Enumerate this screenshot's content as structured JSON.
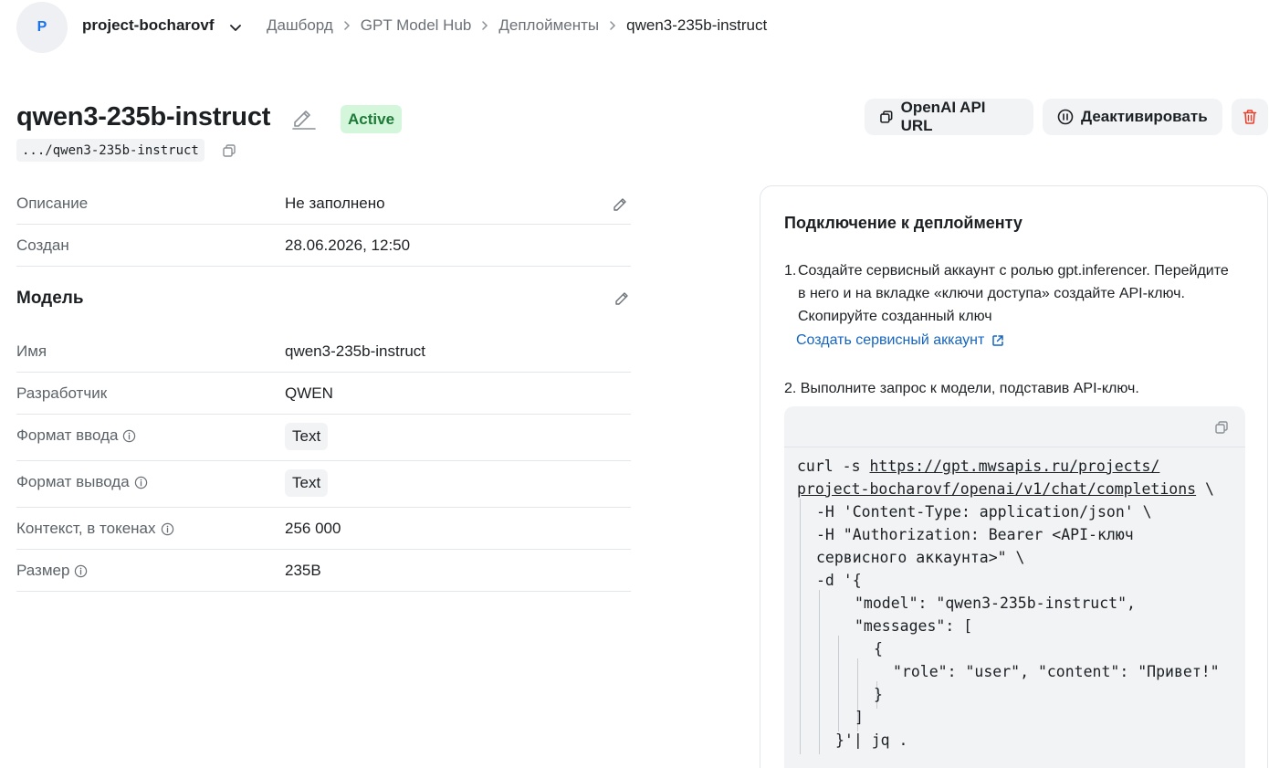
{
  "topbar": {
    "avatar_letter": "P",
    "project_name": "project-bocharovf",
    "breadcrumbs": [
      "Дашборд",
      "GPT Model Hub",
      "Деплойменты",
      "qwen3-235b-instruct"
    ]
  },
  "header": {
    "title": "qwen3-235b-instruct",
    "status": "Active",
    "path": ".../qwen3-235b-instruct",
    "buttons": {
      "api_url": "OpenAI API URL",
      "deactivate": "Деактивировать"
    }
  },
  "details": {
    "description_label": "Описание",
    "description_value": "Не заполнено",
    "created_label": "Создан",
    "created_value": "28.06.2026, 12:50",
    "model_heading": "Модель",
    "name_label": "Имя",
    "name_value": "qwen3-235b-instruct",
    "developer_label": "Разработчик",
    "developer_value": "QWEN",
    "input_format_label": "Формат ввода",
    "input_format_value": "Text",
    "output_format_label": "Формат вывода",
    "output_format_value": "Text",
    "context_label": "Контекст, в токенах",
    "context_value": "256 000",
    "size_label": "Размер",
    "size_value": "235B"
  },
  "connection": {
    "title": "Подключение к деплойменту",
    "step1_num": "1.",
    "step1_text": "Создайте сервисный аккаунт с ролью gpt.inferencer. Перейдите в него и на вкладке «ключи доступа» создайте API-ключ. Скопируйте созданный ключ",
    "create_link": "Создать сервисный аккаунт",
    "step2_text": "2. Выполните запрос к модели, подставив API-ключ.",
    "code": {
      "l1_cmd": "curl -s ",
      "l1_url": "https://gpt.mwsapis.ru/projects/",
      "l2_url": "project-bocharovf/openai/v1/chat/completions",
      "l2_tail": " \\",
      "l3": "-H 'Content-Type: application/json' \\",
      "l4": "-H \"Authorization: Bearer <API-ключ",
      "l5": "сервисного аккаунта>\" \\",
      "l6": "-d '{",
      "l7": "\"model\": \"qwen3-235b-instruct\",",
      "l8": "\"messages\": [",
      "l9": "{",
      "l10": "\"role\": \"user\", \"content\": \"Привет!\"",
      "l11": "}",
      "l12": "]",
      "l13": "}'| jq ."
    }
  },
  "colors": {
    "accent": "#1565c0",
    "active_bg": "#d4f7dc",
    "active_text": "#1f7a38",
    "delete": "#e8412c"
  }
}
